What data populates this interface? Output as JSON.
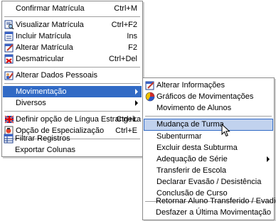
{
  "main_menu": {
    "items": [
      {
        "label": "Confirmar Matrícula",
        "accel": "Ctrl+M"
      },
      {
        "label": "Visualizar Matrícula",
        "accel": "Ctrl+F2",
        "icon": "view-record-icon"
      },
      {
        "label": "Incluir Matrícula",
        "accel": "Ins",
        "icon": "add-record-icon"
      },
      {
        "label": "Alterar Matrícula",
        "accel": "F2",
        "icon": "edit-record-icon"
      },
      {
        "label": "Desmatricular",
        "accel": "Ctrl+Del",
        "icon": "remove-record-icon"
      },
      {
        "label": "Alterar Dados Pessoais",
        "icon": "edit-person-icon"
      },
      {
        "label": "Movimentação"
      },
      {
        "label": "Diversos"
      },
      {
        "label": "Definir opção de Língua Estrangeira",
        "accel": "Ctrl+L",
        "icon": "flag-icon"
      },
      {
        "label": "Opção de Especialização",
        "accel": "Ctrl+E",
        "icon": "specialization-icon"
      },
      {
        "label": "Filtrar Registros",
        "icon": "filter-icon"
      },
      {
        "label": "Exportar Colunas"
      }
    ]
  },
  "sub_menu": {
    "items": [
      {
        "label": "Alterar Informações",
        "icon": "edit-info-icon"
      },
      {
        "label": "Gráficos de Movimentações",
        "icon": "pie-chart-icon"
      },
      {
        "label": "Movimento de Alunos"
      },
      {
        "label": "Mudança de Turma"
      },
      {
        "label": "Subenturmar"
      },
      {
        "label": "Excluir desta Subturma"
      },
      {
        "label": "Adequação de Série"
      },
      {
        "label": "Transferir de Escola"
      },
      {
        "label": "Declarar Evasão / Desistência"
      },
      {
        "label": "Conclusão de Curso"
      },
      {
        "label": "Retornar Aluno Transferido / Evadido"
      },
      {
        "label": "Desfazer a Última Movimentação"
      }
    ]
  },
  "colors": {
    "selection": "#316ac5",
    "hover": "#c1d2ee"
  }
}
